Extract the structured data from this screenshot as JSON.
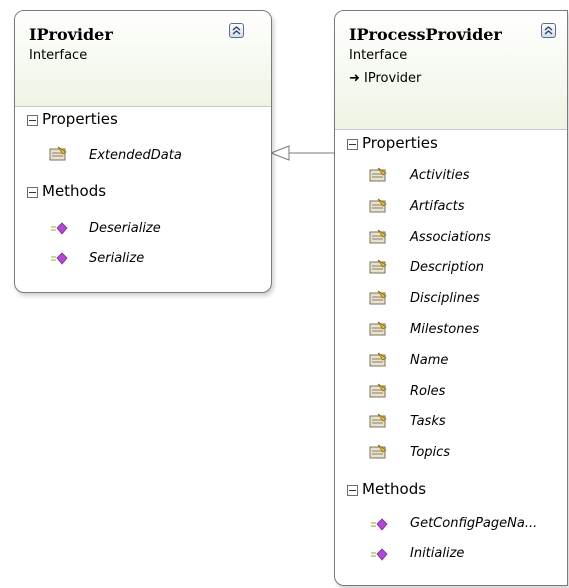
{
  "iprovider": {
    "title": "IProvider",
    "stereotype": "Interface",
    "sections": {
      "properties_label": "Properties",
      "properties": [
        "ExtendedData"
      ],
      "methods_label": "Methods",
      "methods": [
        "Deserialize",
        "Serialize"
      ]
    }
  },
  "iprocessprovider": {
    "title": "IProcessProvider",
    "stereotype": "Interface",
    "inherits": "IProvider",
    "sections": {
      "properties_label": "Properties",
      "properties": [
        "Activities",
        "Artifacts",
        "Associations",
        "Description",
        "Disciplines",
        "Milestones",
        "Name",
        "Roles",
        "Tasks",
        "Topics"
      ],
      "methods_label": "Methods",
      "methods": [
        "GetConfigPageNa...",
        "Initialize"
      ]
    }
  },
  "colors": {
    "header_gradient_end": "#eef4e4",
    "method_icon": "#b04ad0",
    "border": "#7a7a7a"
  }
}
